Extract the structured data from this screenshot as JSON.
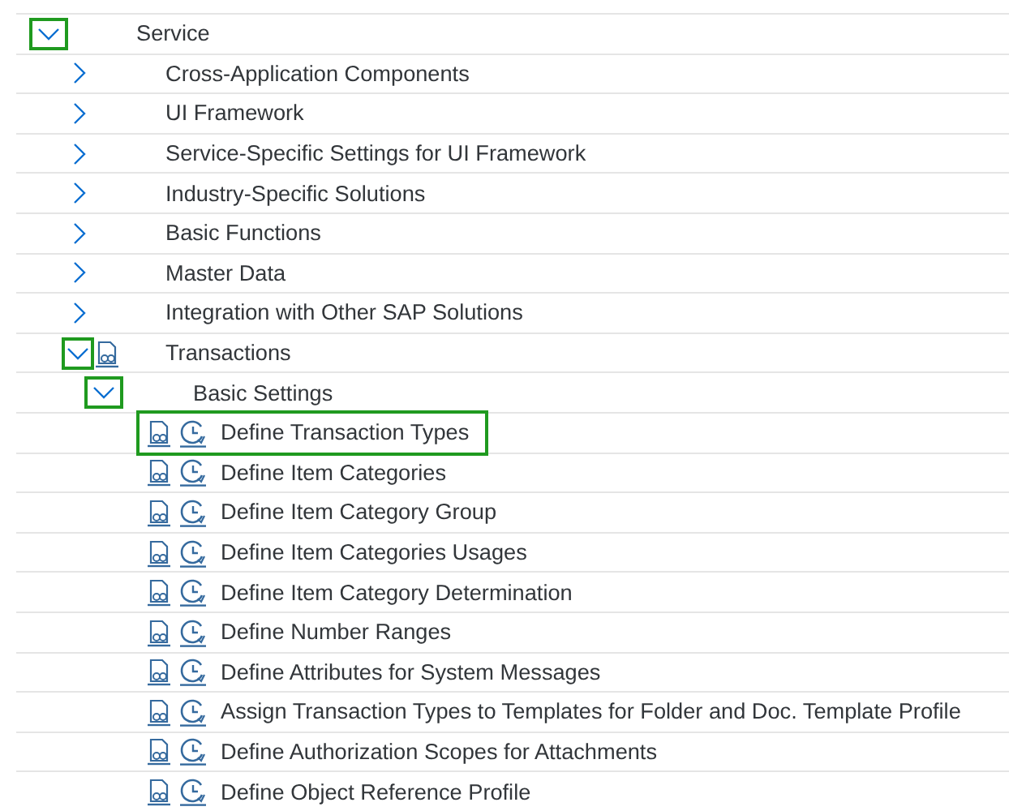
{
  "tree": [
    {
      "label": "Service",
      "kind": "folder",
      "expanded": true,
      "highlighted": true,
      "children": [
        {
          "label": "Cross-Application Components",
          "kind": "folder",
          "expanded": false,
          "highlighted": false
        },
        {
          "label": "UI Framework",
          "kind": "folder",
          "expanded": false,
          "highlighted": false
        },
        {
          "label": "Service-Specific Settings for UI Framework",
          "kind": "folder",
          "expanded": false,
          "highlighted": false
        },
        {
          "label": "Industry-Specific Solutions",
          "kind": "folder",
          "expanded": false,
          "highlighted": false
        },
        {
          "label": "Basic Functions",
          "kind": "folder",
          "expanded": false,
          "highlighted": false
        },
        {
          "label": "Master Data",
          "kind": "folder",
          "expanded": false,
          "highlighted": false
        },
        {
          "label": "Integration with Other SAP Solutions",
          "kind": "folder",
          "expanded": false,
          "highlighted": false
        },
        {
          "label": "Transactions",
          "kind": "documented-folder",
          "expanded": true,
          "highlighted": true,
          "children": [
            {
              "label": "Basic Settings",
              "kind": "folder",
              "expanded": true,
              "highlighted": true,
              "children": [
                {
                  "label": "Define Transaction Types",
                  "kind": "activity",
                  "highlighted": true
                },
                {
                  "label": "Define Item Categories",
                  "kind": "activity",
                  "highlighted": false
                },
                {
                  "label": "Define Item Category Group",
                  "kind": "activity",
                  "highlighted": false
                },
                {
                  "label": "Define Item Categories Usages",
                  "kind": "activity",
                  "highlighted": false
                },
                {
                  "label": "Define Item Category Determination",
                  "kind": "activity",
                  "highlighted": false
                },
                {
                  "label": "Define Number Ranges",
                  "kind": "activity",
                  "highlighted": false
                },
                {
                  "label": "Define Attributes for System Messages",
                  "kind": "activity",
                  "highlighted": false
                },
                {
                  "label": "Assign Transaction Types to Templates for Folder and Doc. Template Profile",
                  "kind": "activity",
                  "highlighted": false
                },
                {
                  "label": "Define Authorization Scopes for Attachments",
                  "kind": "activity",
                  "highlighted": false
                },
                {
                  "label": "Define Object Reference Profile",
                  "kind": "activity",
                  "highlighted": false
                }
              ]
            }
          ]
        }
      ]
    }
  ]
}
